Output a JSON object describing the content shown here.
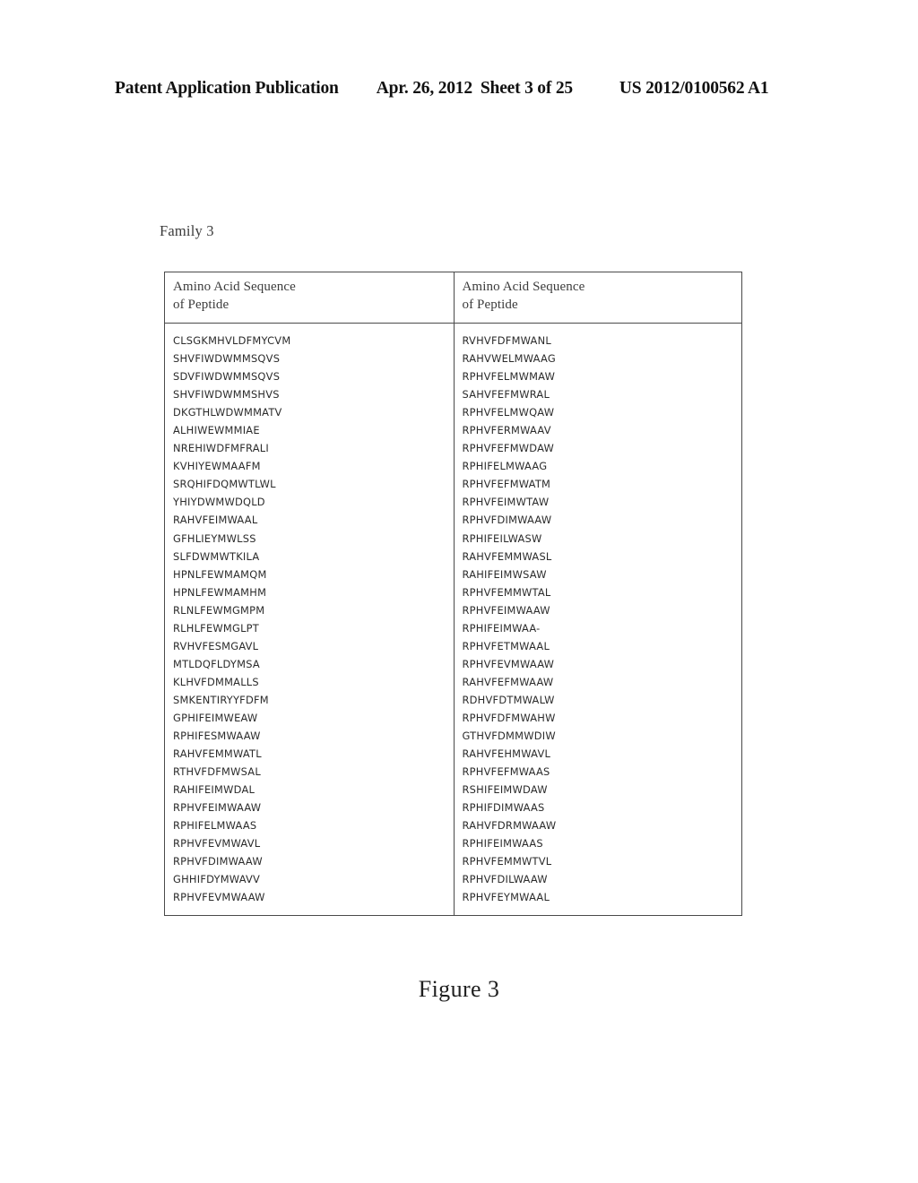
{
  "header": {
    "publication": "Patent Application Publication",
    "date": "Apr. 26, 2012",
    "sheet": "Sheet 3 of 25",
    "doc_number": "US 2012/0100562 A1"
  },
  "family_label": "Family 3",
  "table": {
    "columns": [
      {
        "header_line1": "Amino Acid Sequence",
        "header_line2": "of Peptide"
      },
      {
        "header_line1": "Amino Acid Sequence",
        "header_line2": "of Peptide"
      }
    ],
    "left_column": [
      "CLSGKMHVLDFMYCVM",
      "SHVFIWDWMMSQVS",
      "SDVFIWDWMMSQVS",
      "SHVFIWDWMMSHVS",
      "DKGTHLWDWMMATV",
      "ALHIWEWMMIAE",
      "NREHIWDFMFRALI",
      "KVHIYEWMAAFM",
      "SRQHIFDQMWTLWL",
      "YHIYDWMWDQLD",
      "RAHVFEIMWAAL",
      "GFHLIEYMWLSS",
      "SLFDWMWTKILA",
      "HPNLFEWMAMQM",
      "HPNLFEWMAMHM",
      "RLNLFEWMGMPM",
      "RLHLFEWMGLPT",
      "RVHVFESMGAVL",
      "MTLDQFLDYMSA",
      "KLHVFDMMALLS",
      "SMKENTIRYYFDFM",
      "GPHIFEIMWEAW",
      "RPHIFESMWAAW",
      "RAHVFEMMWATL",
      "RTHVFDFMWSAL",
      "RAHIFEIMWDAL",
      "RPHVFEIMWAAW",
      "RPHIFELMWAAS",
      "RPHVFEVMWAVL",
      "RPHVFDIMWAAW",
      "GHHIFDYMWAVV",
      "RPHVFEVMWAAW"
    ],
    "right_column": [
      "RVHVFDFMWANL",
      "RAHVWELMWAAG",
      "RPHVFELMWMAW",
      "SAHVFEFMWRAL",
      "RPHVFELMWQAW",
      "RPHVFERMWAAV",
      "RPHVFEFMWDAW",
      "RPHIFELMWAAG",
      "RPHVFEFMWATM",
      "RPHVFEIMWTAW",
      "RPHVFDIMWAAW",
      "RPHIFEILWASW",
      "RAHVFEMMWASL",
      "RAHIFEIMWSAW",
      "RPHVFEMMWTAL",
      "RPHVFEIMWAAW",
      "RPHIFEIMWAA-",
      "RPHVFETMWAAL",
      "RPHVFEVMWAAW",
      "RAHVFEFMWAAW",
      "RDHVFDTMWALW",
      "RPHVFDFMWAHW",
      "GTHVFDMMWDIW",
      "RAHVFEHMWAVL",
      "RPHVFEFMWAAS",
      "RSHIFEIMWDAW",
      "RPHIFDIMWAAS",
      "RAHVFDRMWAAW",
      "RPHIFEIMWAAS",
      "RPHVFEMMWTVL",
      "RPHVFDILWAAW",
      "RPHVFEYMWAAL"
    ]
  },
  "figure_caption": "Figure 3"
}
